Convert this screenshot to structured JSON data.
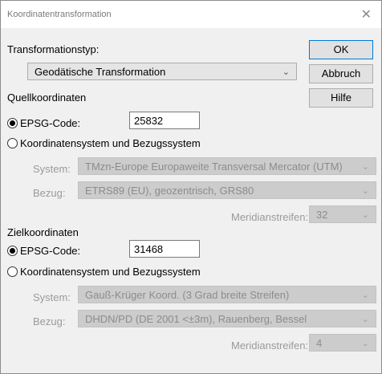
{
  "window": {
    "title": "Koordinatentransformation",
    "close_glyph": "✕"
  },
  "buttons": {
    "ok": "OK",
    "cancel": "Abbruch",
    "help": "Hilfe"
  },
  "transformation": {
    "label": "Transformationstyp:",
    "value": "Geodätische Transformation"
  },
  "source": {
    "heading": "Quellkoordinaten",
    "epsg_label": "EPSG-Code:",
    "epsg_value": "25832",
    "epsg_selected": true,
    "crs_label": "Koordinatensystem und Bezugssystem",
    "system_label": "System:",
    "system_value": "TMzn-Europe Europaweite Transversal Mercator (UTM)",
    "datum_label": "Bezug:",
    "datum_value": "ETRS89 (EU), geozentrisch, GRS80",
    "meridian_label": "Meridianstreifen:",
    "meridian_value": "32"
  },
  "target": {
    "heading": "Zielkoordinaten",
    "epsg_label": "EPSG-Code:",
    "epsg_value": "31468",
    "epsg_selected": true,
    "crs_label": "Koordinatensystem und Bezugssystem",
    "system_label": "System:",
    "system_value": "Gauß-Krüger Koord. (3 Grad breite Streifen)",
    "datum_label": "Bezug:",
    "datum_value": "DHDN/PD (DE 2001 <±3m), Rauenberg, Bessel",
    "meridian_label": "Meridianstreifen:",
    "meridian_value": "4"
  },
  "icons": {
    "dropdown": "chevron-down-icon",
    "close": "close-icon"
  }
}
